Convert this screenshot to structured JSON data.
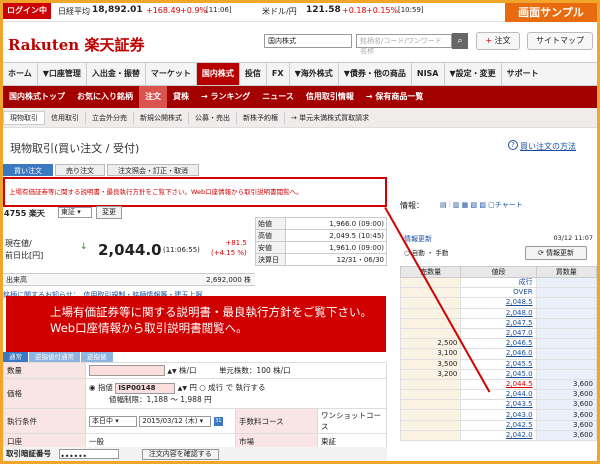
{
  "topbar": {
    "login_label": "ログイン中",
    "nikkei": {
      "name": "日経平均",
      "value": "18,892.01",
      "change": "+168.49",
      "pct": "+0.9%",
      "time": "[11:06]"
    },
    "usd": {
      "name": "米ドル/円",
      "value": "121.58",
      "change": "+0.18",
      "pct": "+0.15%",
      "time": "[10:59]"
    },
    "sample_label": "画面サンプル"
  },
  "header": {
    "logo_brand": "Rakuten",
    "logo_jp": "楽天証券",
    "search_select": "国内株式",
    "search_placeholder": "銘柄名/コード/ワンワード名称",
    "order_label": "注文",
    "sitemap_label": "サイトマップ"
  },
  "mainnav": [
    "ホーム",
    "▼口座管理",
    "入出金・振替",
    "マーケット",
    "国内株式",
    "投信",
    "FX",
    "▼海外株式",
    "▼債券・他の商品",
    "NISA",
    "▼設定・変更",
    "サポート"
  ],
  "mainnav_active": "国内株式",
  "subnav": [
    "国内株式トップ",
    "お気に入り銘柄",
    "注文",
    "貸株",
    "→ ランキング",
    "ニュース",
    "信用取引情報",
    "→ 保有商品一覧"
  ],
  "subnav_active": "注文",
  "thirdnav": [
    "現物取引",
    "信用取引",
    "立会外分売",
    "新規公開株式",
    "公募・売出",
    "新株予約権",
    "→ 単元未満株式買取請求"
  ],
  "thirdnav_active": "現物取引",
  "page": {
    "title": "現物取引(買い注文 / 受付)",
    "howto": "買い注文の方法"
  },
  "tabs": [
    "買い注文",
    "売り注文",
    "注文照会・訂正・取消"
  ],
  "notice_small": "上場有価証券等に関する説明書・最良執行方針をご覧下さい。Web口座情報から取引説明書閲覧へ。",
  "notice_big_line1": "上場有価証券等に関する説明書・最良執行方針をご覧下さい。",
  "notice_big_line2": "Web口座情報から取引説明書閲覧へ。",
  "stock": {
    "code": "4755",
    "name": "楽天",
    "market": "東証",
    "change_btn": "変更",
    "price_label_1": "現在値/",
    "price_label_2": "前日比[円]",
    "price": "2,044.0",
    "price_time": "(11:06:55)",
    "diff": "+81.5",
    "diff_pct": "(+4.15 %)",
    "volume_label": "出来高",
    "volume": "2,692,000 株",
    "settle_label": "決算日",
    "settle": "12/31・06/30"
  },
  "ohl": [
    {
      "k": "始値",
      "v": "1,966.0 (09:00)"
    },
    {
      "k": "高値",
      "v": "2,049.5 (10:45)"
    },
    {
      "k": "安値",
      "v": "1,961.0 (09:00)"
    }
  ],
  "info_link": "銘柄に関するお知らせ：　信用取引規制・銘柄情報等・建玉上限",
  "order_tabs": [
    "通常",
    "逆指値付通常",
    "逆指値"
  ],
  "form": {
    "qty_label": "数量",
    "qty_unit": "株/口",
    "lot": "単元株数：100 株/口",
    "price_label": "価格",
    "limit_label": "指値",
    "limit_value": "ISP00148",
    "yen": "円",
    "market_label": "成行",
    "market_suffix": "で 執行する",
    "range": "値幅制限：1,188 〜 1,988 円",
    "cond_label": "執行条件",
    "cond_value": "本日中",
    "date_value": "2015/03/12 (木)",
    "fee_label": "手数料コース",
    "fee_value": "ワンショットコース",
    "acct_label": "口座",
    "acct_value": "一般",
    "mkt_label": "市場",
    "mkt_value": "東証",
    "pw_label": "取引暗証番号",
    "pw_value": "••••••",
    "confirm_btn": "注文内容を確認する"
  },
  "side": {
    "info_label": "情報：",
    "icons": "チャート",
    "update": "情報更新",
    "date": "03/12 11:07",
    "radio": "自動 ・ 手動",
    "info_btn": "情報更新",
    "headers": [
      "売数量",
      "値段",
      "買数量"
    ],
    "rows": [
      [
        "",
        "成行",
        ""
      ],
      [
        "",
        "OVER",
        ""
      ],
      [
        "",
        "2,048.5",
        ""
      ],
      [
        "",
        "2,048.0",
        ""
      ],
      [
        "",
        "2,047.5",
        ""
      ],
      [
        "",
        "2,047.0",
        ""
      ],
      [
        "2,500",
        "2,046.5",
        ""
      ],
      [
        "3,100",
        "2,046.0",
        ""
      ],
      [
        "3,500",
        "2,045.5",
        ""
      ],
      [
        "3,200",
        "2,045.0",
        ""
      ],
      [
        "",
        "2,044.5",
        "3,600"
      ],
      [
        "",
        "2,044.0",
        "3,600"
      ],
      [
        "",
        "2,043.5",
        "3,600"
      ],
      [
        "",
        "2,043.0",
        "3,600"
      ],
      [
        "",
        "2,042.5",
        "3,600"
      ],
      [
        "",
        "2,042.0",
        "3,600"
      ]
    ]
  }
}
